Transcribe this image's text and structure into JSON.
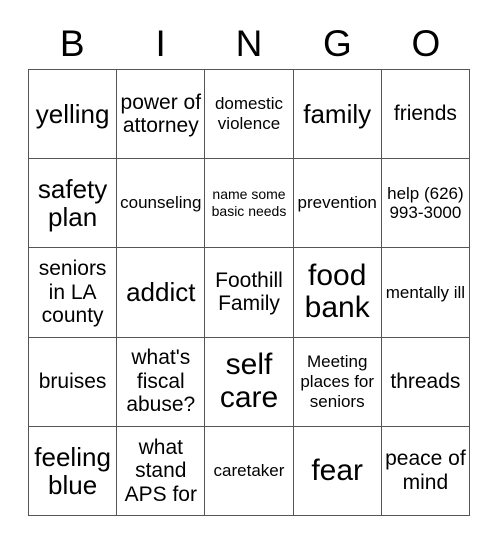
{
  "card": {
    "title": "BINGO",
    "headers": [
      "B",
      "I",
      "N",
      "G",
      "O"
    ],
    "grid_size": "5x5",
    "colors": {
      "text": "#000000",
      "border": "#555555",
      "background": "#ffffff"
    },
    "rows": [
      {
        "cells": [
          {
            "text": "yelling",
            "size": "lg"
          },
          {
            "text": "power of attorney",
            "size": "md"
          },
          {
            "text": "domestic violence",
            "size": "sm"
          },
          {
            "text": "family",
            "size": "lg"
          },
          {
            "text": "friends",
            "size": "md"
          }
        ]
      },
      {
        "cells": [
          {
            "text": "safety plan",
            "size": "lg"
          },
          {
            "text": "counseling",
            "size": "sm"
          },
          {
            "text": "name some basic needs",
            "size": "xs"
          },
          {
            "text": "prevention",
            "size": "sm"
          },
          {
            "text": "help (626) 993-3000",
            "size": "sm"
          }
        ]
      },
      {
        "cells": [
          {
            "text": "seniors in LA county",
            "size": "md"
          },
          {
            "text": "addict",
            "size": "lg"
          },
          {
            "text": "Foothill Family",
            "size": "md"
          },
          {
            "text": "food bank",
            "size": "xl"
          },
          {
            "text": "mentally ill",
            "size": "sm"
          }
        ]
      },
      {
        "cells": [
          {
            "text": "bruises",
            "size": "md"
          },
          {
            "text": "what's fiscal abuse?",
            "size": "md"
          },
          {
            "text": "self care",
            "size": "xl"
          },
          {
            "text": "Meeting places for seniors",
            "size": "sm"
          },
          {
            "text": "threads",
            "size": "md"
          }
        ]
      },
      {
        "cells": [
          {
            "text": "feeling blue",
            "size": "lg"
          },
          {
            "text": "what stand APS for",
            "size": "md"
          },
          {
            "text": "caretaker",
            "size": "sm"
          },
          {
            "text": "fear",
            "size": "xl"
          },
          {
            "text": "peace of mind",
            "size": "md"
          }
        ]
      }
    ]
  }
}
